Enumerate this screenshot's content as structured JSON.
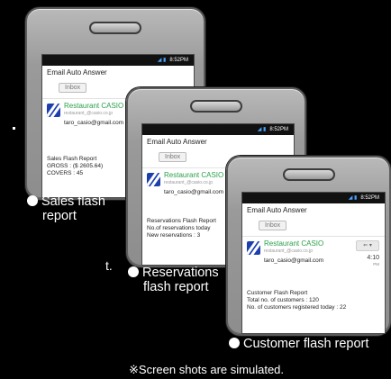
{
  "edge_text": {
    "period": "t."
  },
  "phones": [
    {
      "status": {
        "time": "8:52PM"
      },
      "app_title": "Email Auto Answer",
      "inbox_label": "Inbox",
      "sender_name": "Restaurant CASIO",
      "sender_sub": "restaurant_@casio.co.jp",
      "sender_email": "taro_casio@gmail.com",
      "report_lines": [
        "Sales Flash Report",
        "GROSS : ($ 2605.64)",
        "COVERS : 45"
      ],
      "caption": [
        "Sales flash",
        "report"
      ]
    },
    {
      "status": {
        "time": "8:52PM"
      },
      "app_title": "Email Auto Answer",
      "inbox_label": "Inbox",
      "sender_name": "Restaurant CASIO",
      "sender_sub": "restaurant_@casio.co.jp",
      "sender_email": "taro_casio@gmail.com",
      "report_lines": [
        "Reservations Flash Report",
        "No.of reservations today",
        "New reservations : 3"
      ],
      "caption": [
        "Reservations",
        "flash report"
      ]
    },
    {
      "status": {
        "time": "8:52PM"
      },
      "app_title": "Email Auto Answer",
      "inbox_label": "Inbox",
      "sender_name": "Restaurant CASIO",
      "sender_sub": "restaurant_@casio.co.jp",
      "sender_email": "taro_casio@gmail.com",
      "meta_button": "⇐ ▾",
      "meta_time": "4:10",
      "meta_time_sub": "PM",
      "report_lines": [
        "Customer Flash Report",
        "Total no. of customers : 120",
        "No. of customers registered today : 22"
      ],
      "caption": [
        "Customer flash report"
      ]
    }
  ],
  "footnote": "※Screen shots are simulated."
}
